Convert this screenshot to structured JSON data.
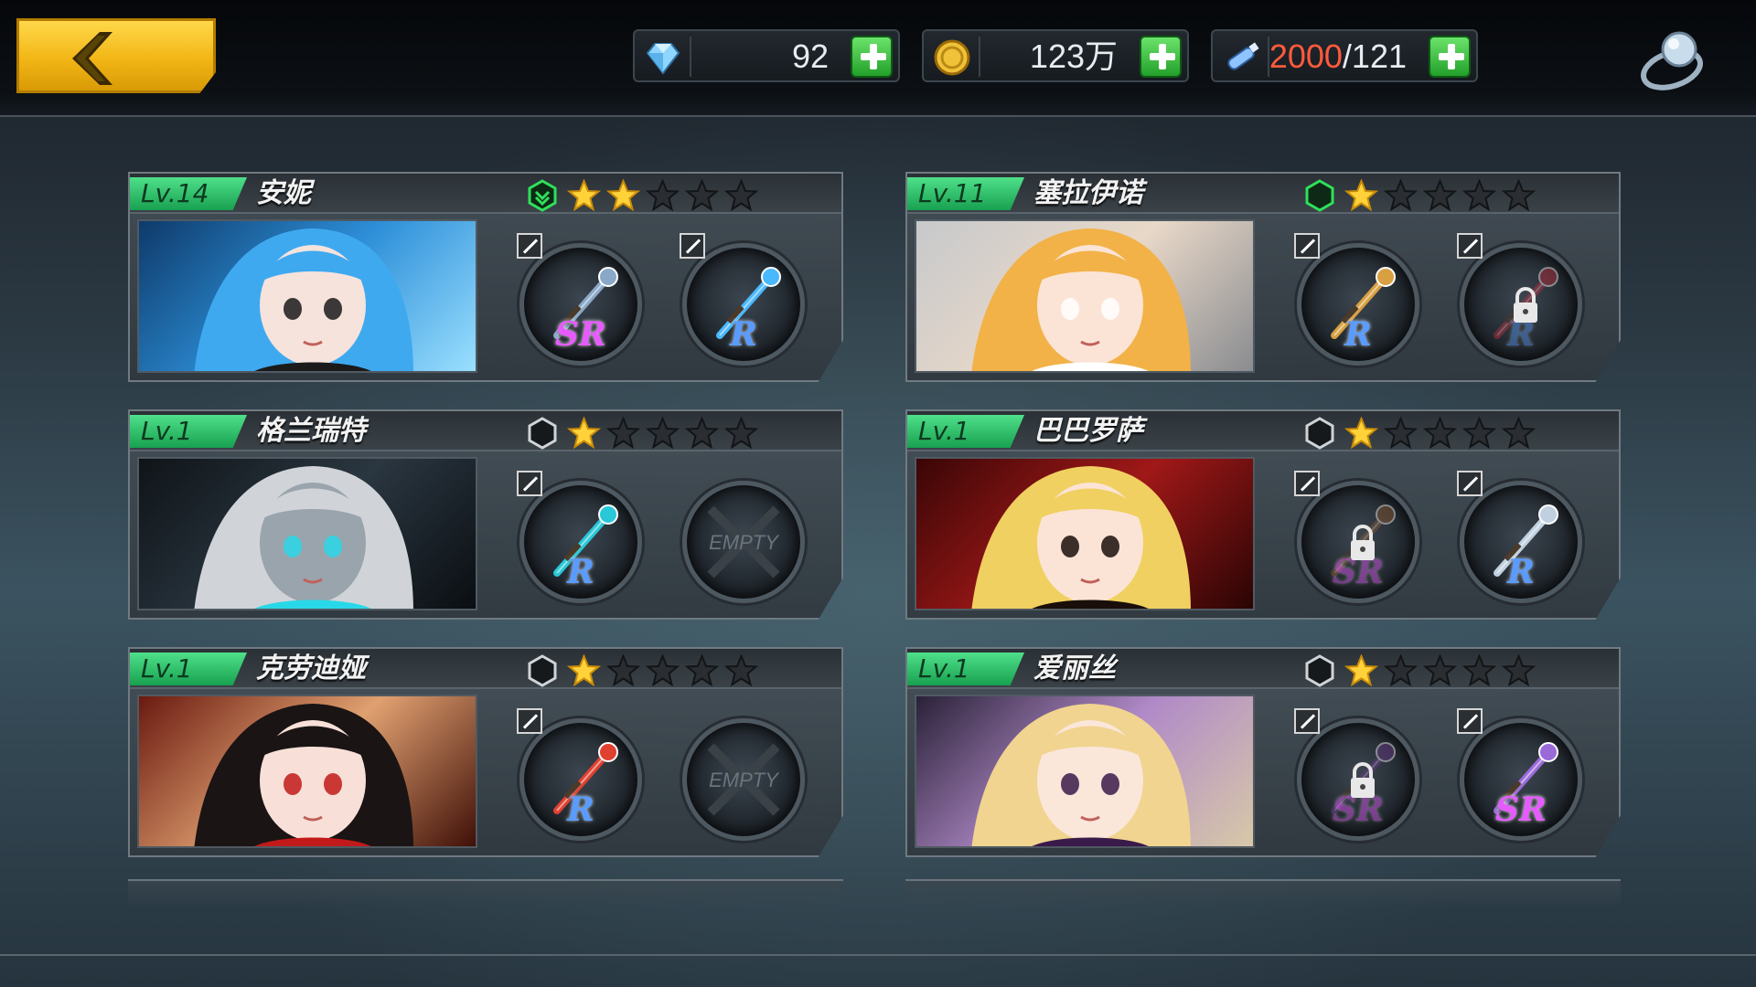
{
  "currencies": {
    "diamonds": {
      "value": "92"
    },
    "gold": {
      "value": "123万"
    },
    "stamina": {
      "current": "2000",
      "max": "/121"
    }
  },
  "colors": {
    "accent_yellow": "#f2b616",
    "level_green": "#2fc46e",
    "stamina_red": "#ff5a3c",
    "sr_purple": "#e65bff",
    "r_blue": "#5a9bff"
  },
  "characters": [
    {
      "level": "Lv.14",
      "name": "安妮",
      "stars": 2,
      "hex": "green-check",
      "portrait": "blue-hair-girl",
      "slots": [
        {
          "state": "equipped",
          "rarity": "SR",
          "weapon": "gun-icon"
        },
        {
          "state": "equipped",
          "rarity": "R",
          "weapon": "staff-icon"
        }
      ]
    },
    {
      "level": "Lv.11",
      "name": "塞拉伊诺",
      "stars": 1,
      "hex": "green",
      "portrait": "blonde-girl-white-hat",
      "slots": [
        {
          "state": "equipped",
          "rarity": "R",
          "weapon": "sword-icon"
        },
        {
          "state": "locked",
          "rarity": "R",
          "weapon": "blade-icon"
        }
      ]
    },
    {
      "level": "Lv.1",
      "name": "格兰瑞特",
      "stars": 1,
      "hex": "dark",
      "portrait": "armored-knight",
      "slots": [
        {
          "state": "equipped",
          "rarity": "R",
          "weapon": "scythe-icon"
        },
        {
          "state": "empty",
          "label": "EMPTY"
        }
      ]
    },
    {
      "level": "Lv.1",
      "name": "巴巴罗萨",
      "stars": 1,
      "hex": "dark",
      "portrait": "blonde-pirate-girl",
      "slots": [
        {
          "state": "locked",
          "rarity": "SR",
          "weapon": "rifle-icon"
        },
        {
          "state": "equipped",
          "rarity": "R",
          "weapon": "twin-blades-icon"
        }
      ]
    },
    {
      "level": "Lv.1",
      "name": "克劳迪娅",
      "stars": 1,
      "hex": "dark",
      "portrait": "witch-girl-black-hair",
      "slots": [
        {
          "state": "equipped",
          "rarity": "R",
          "weapon": "rose-staff-icon"
        },
        {
          "state": "empty",
          "label": "EMPTY"
        }
      ]
    },
    {
      "level": "Lv.1",
      "name": "爱丽丝",
      "stars": 1,
      "hex": "dark",
      "portrait": "blonde-girl-scythe",
      "slots": [
        {
          "state": "locked",
          "rarity": "SR",
          "weapon": "scythe-dark-icon"
        },
        {
          "state": "equipped",
          "rarity": "SR",
          "weapon": "crescent-blade-icon"
        }
      ]
    }
  ]
}
